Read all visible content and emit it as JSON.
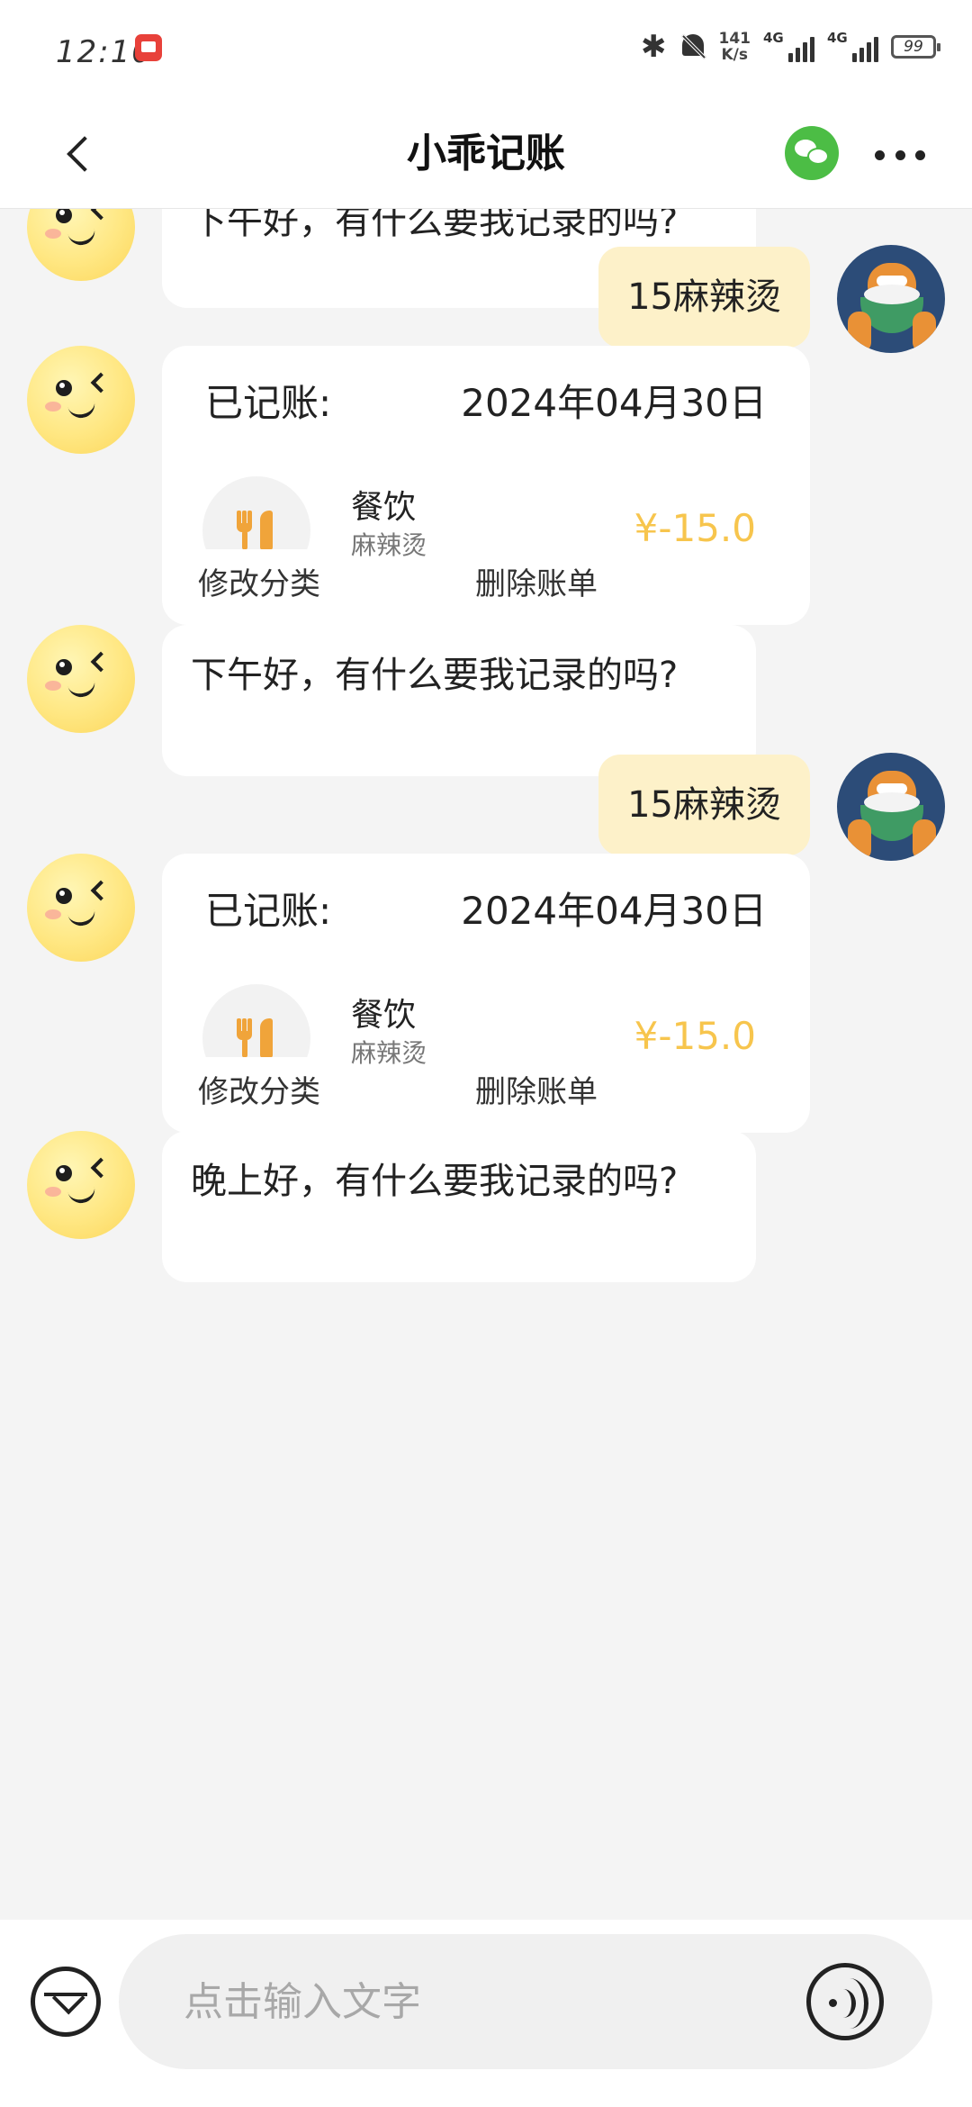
{
  "status_bar": {
    "time": "12:10",
    "net_speed_value": "141",
    "net_speed_unit": "K/s",
    "signal1_label": "4G",
    "signal2_label": "4G",
    "battery": "99"
  },
  "header": {
    "title": "小乖记账"
  },
  "messages": {
    "greeting_1": "下午好，有什么要我记录的吗?",
    "user_1": "15麻辣烫",
    "record_1": {
      "label": "已记账:",
      "date": "2024年04月30日",
      "category": "餐饮",
      "note": "麻辣烫",
      "amount": "¥-15.0"
    },
    "greeting_2": "下午好，有什么要我记录的吗?",
    "user_2": "15麻辣烫",
    "record_2": {
      "label": "已记账:",
      "date": "2024年04月30日",
      "category": "餐饮",
      "note": "麻辣烫",
      "amount": "¥-15.0"
    },
    "greeting_3": "晚上好，有什么要我记录的吗?"
  },
  "actions": {
    "modify_category": "修改分类",
    "delete_bill": "删除账单"
  },
  "input": {
    "placeholder": "点击输入文字"
  },
  "colors": {
    "accent_yellow": "#fdf1c9",
    "amount_color": "#f7c54d",
    "icon_orange": "#f0a43a",
    "wechat_green": "#4cbd45"
  },
  "icons": {
    "back": "chevron-left-icon",
    "wechat": "wechat-icon",
    "more": "more-dots-icon",
    "bill": "bill-icon",
    "voice": "voice-icon",
    "category": "fork-knife-icon"
  }
}
